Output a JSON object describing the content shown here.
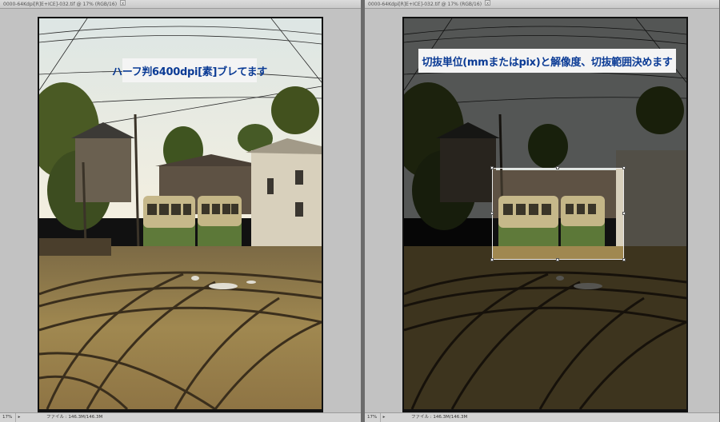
{
  "left_window": {
    "title": "0000-64Kdpi[R]E+ICE]-032.tif @ 17% (RGB/16)",
    "close_glyph": "x",
    "zoom": "17%",
    "file_info": "ファイル : 146.3M/146.3M",
    "caption": "ハーフ判6400dpi[素]ブレてます"
  },
  "right_window": {
    "title": "0000-64Kdpi[R]E+ICE]-032.tif @ 17% (RGB/16)",
    "close_glyph": "x",
    "zoom": "17%",
    "file_info": "ファイル : 146.3M/146.3M",
    "caption": "切抜単位(mmまたはpix)と解像度、切抜範囲決めます"
  },
  "colors": {
    "caption_text": "#0b3b95",
    "caption_bg": "#f4f4f4",
    "workspace_gray": "#c2c2c2"
  }
}
